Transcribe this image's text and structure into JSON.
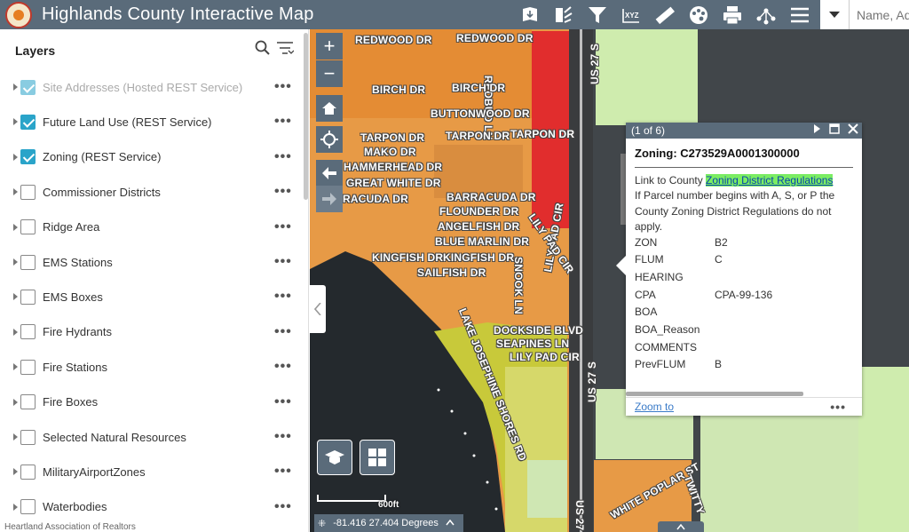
{
  "header": {
    "title": "Highlands County Interactive Map",
    "tools": [
      "print-basemap-icon",
      "measure-route-icon",
      "filter-icon",
      "xyz-coordinates-icon",
      "ruler-icon",
      "palette-icon",
      "printer-icon",
      "share-icon",
      "menu-icon"
    ],
    "xyz_label": "XYZ",
    "search_placeholder": "Name, Ad"
  },
  "panel": {
    "title": "Layers",
    "layers": [
      {
        "label": "Site Addresses (Hosted REST Service)",
        "checked": true,
        "dim": true
      },
      {
        "label": "Future Land Use (REST Service)",
        "checked": true,
        "dim": false
      },
      {
        "label": "Zoning (REST Service)",
        "checked": true,
        "dim": false
      },
      {
        "label": "Commissioner Districts",
        "checked": false,
        "dim": false
      },
      {
        "label": "Ridge Area",
        "checked": false,
        "dim": false
      },
      {
        "label": "EMS Stations",
        "checked": false,
        "dim": false
      },
      {
        "label": "EMS Boxes",
        "checked": false,
        "dim": false
      },
      {
        "label": "Fire Hydrants",
        "checked": false,
        "dim": false
      },
      {
        "label": "Fire Stations",
        "checked": false,
        "dim": false
      },
      {
        "label": "Fire Boxes",
        "checked": false,
        "dim": false
      },
      {
        "label": "Selected Natural Resources",
        "checked": false,
        "dim": false
      },
      {
        "label": "MilitaryAirportZones",
        "checked": false,
        "dim": false
      },
      {
        "label": "Waterbodies",
        "checked": false,
        "dim": false
      }
    ],
    "more_glyph": "•••"
  },
  "map": {
    "zoom_in": "+",
    "zoom_out": "−",
    "road_labels": [
      "REDWOOD DR",
      "REDWOOD DR",
      "REDBUD LN",
      "BIRCH DR",
      "BIRCH DR",
      "BUTTONWOOD DR",
      "TARPON DR",
      "TARPON DR",
      "TARPON DR",
      "MAKO DR",
      "HAMMERHEAD DR",
      "GREAT WHITE DR",
      "RACUDA DR",
      "BARRACUDA DR",
      "FLOUNDER DR",
      "ANGELFISH DR",
      "BLUE MARLIN DR",
      "KINGFISH DR",
      "KINGFISH DR",
      "SAILFISH DR",
      "SNOOK LN",
      "LILY PAD CIR",
      "LILY PAD CIR",
      "LAKE JOSEPHINE SHORES RD",
      "DOCKSIDE BLVD",
      "SEAPINES LN",
      "LILY PAD CIR",
      "US 27 S",
      "US 27 S",
      "US 27 S",
      "WHITE POPLAR ST",
      "TWITTY"
    ],
    "scale_label": "600ft",
    "coordinates": "-81.416 27.404 Degrees",
    "watermark": "Heartland Association of Realtors"
  },
  "popup": {
    "counter": "(1 of 6)",
    "title": "Zoning: C273529A0001300000",
    "intro": "Link to County ",
    "link_text": "Zoning District Regulations",
    "note": "If Parcel number begins with A, S, or P the County Zoning District Regulations do not apply.",
    "attributes": [
      {
        "key": "ZON",
        "value": "B2"
      },
      {
        "key": "FLUM",
        "value": "C"
      },
      {
        "key": "HEARING",
        "value": ""
      },
      {
        "key": "CPA",
        "value": "CPA-99-136"
      },
      {
        "key": "BOA",
        "value": ""
      },
      {
        "key": "BOA_Reason",
        "value": ""
      },
      {
        "key": "COMMENTS",
        "value": ""
      },
      {
        "key": "PrevFLUM",
        "value": "B"
      }
    ],
    "zoom_to": "Zoom to",
    "more_glyph": "•••"
  }
}
